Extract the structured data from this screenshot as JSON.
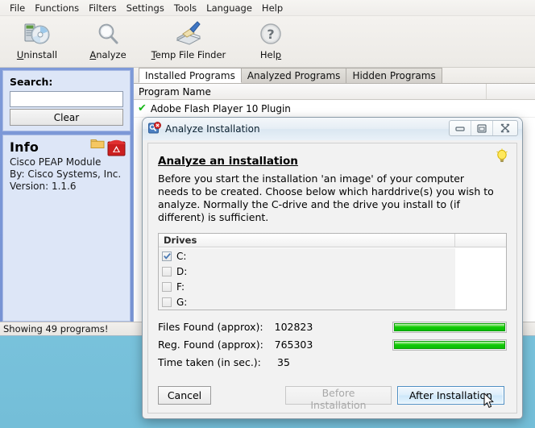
{
  "app": {
    "menubar": [
      "File",
      "Functions",
      "Filters",
      "Settings",
      "Tools",
      "Language",
      "Help"
    ],
    "toolbar": [
      {
        "label_pre": "",
        "accel": "U",
        "label_post": "ninstall",
        "icon": "uninstall-disc-icon"
      },
      {
        "label_pre": "",
        "accel": "A",
        "label_post": "nalyze",
        "icon": "magnifier-icon"
      },
      {
        "label_pre": "",
        "accel": "T",
        "label_post": "emp File Finder",
        "icon": "broom-icon"
      },
      {
        "label_pre": "Hel",
        "accel": "p",
        "label_post": "",
        "icon": "question-mark-icon"
      }
    ],
    "statusbar": "Showing 49 programs!"
  },
  "sidebar": {
    "search": {
      "title": "Search:",
      "value": "",
      "placeholder": "",
      "clear_label": "Clear"
    },
    "info": {
      "title": "Info",
      "line1": "Cisco PEAP Module",
      "line2": "By: Cisco Systems, Inc.",
      "line3": "Version: 1.1.6",
      "folder_icon": "folder-icon",
      "badge_icon": "red-box-icon"
    }
  },
  "list": {
    "tabs": [
      {
        "label": "Installed Programs",
        "active": true
      },
      {
        "label": "Analyzed Programs",
        "active": false
      },
      {
        "label": "Hidden Programs",
        "active": false
      }
    ],
    "column_header": "Program Name",
    "rows": [
      {
        "check": "✔",
        "name": "Adobe Flash Player 10 Plugin"
      }
    ]
  },
  "dialog": {
    "title": "Analyze Installation",
    "window_buttons": {
      "minimize": "minimize-icon",
      "maximize": "maximize-icon",
      "close": "close-icon"
    },
    "heading": "Analyze an installation",
    "description": "Before you start the installation 'an image' of your computer needs to be created. Choose below which harddrive(s) you wish to analyze. Normally the C-drive and the drive you install to (if different) is sufficient.",
    "hint_icon": "lightbulb-icon",
    "drives": {
      "header": "Drives",
      "items": [
        {
          "label": "C:",
          "checked": true
        },
        {
          "label": "D:",
          "checked": false
        },
        {
          "label": "F:",
          "checked": false
        },
        {
          "label": "G:",
          "checked": false
        }
      ]
    },
    "stats": [
      {
        "label": "Files Found (approx):",
        "value": "102823",
        "progress": 100
      },
      {
        "label": "Reg. Found (approx):",
        "value": "765303",
        "progress": 100
      },
      {
        "label": "Time taken (in sec.):",
        "value": "35",
        "progress": null
      }
    ],
    "buttons": {
      "cancel": "Cancel",
      "before": "Before Installation",
      "after": "After Installation"
    }
  },
  "colors": {
    "sidebar_blue": "#7793d4",
    "panel_blue": "#dde6f7",
    "desktop_blue": "#7dc6df",
    "progress_green": "#12cc07",
    "checkmark_green": "#18b81a",
    "focus_blue": "#4e8fc4"
  }
}
